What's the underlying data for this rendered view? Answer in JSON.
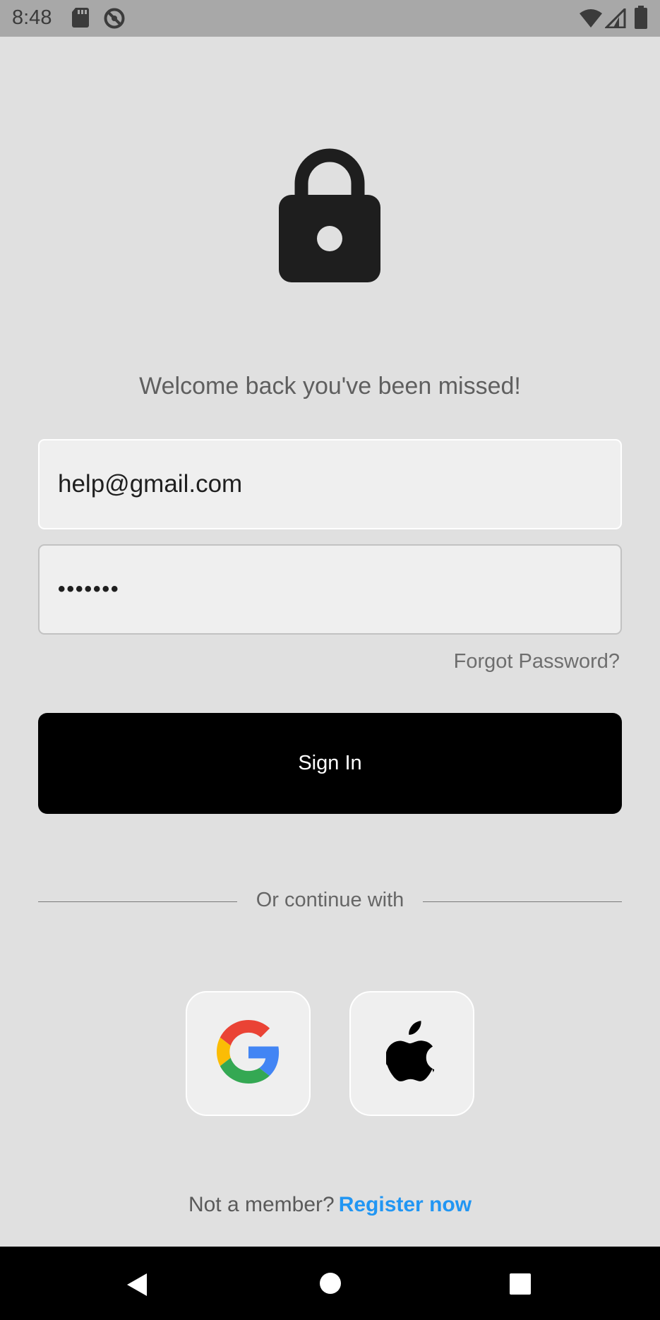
{
  "status_bar": {
    "time": "8:48",
    "icons": [
      "sd-card-icon",
      "do-not-disturb-icon",
      "wifi-icon",
      "signal-icon",
      "battery-icon"
    ]
  },
  "header": {
    "icon": "lock-icon",
    "welcome_text": "Welcome back you've been missed!"
  },
  "form": {
    "email_value": "help@gmail.com",
    "password_value": "•••••••",
    "forgot_label": "Forgot Password?",
    "signin_label": "Sign In"
  },
  "divider": {
    "text": "Or continue with"
  },
  "social": [
    {
      "name": "google",
      "icon": "google-logo-icon"
    },
    {
      "name": "apple",
      "icon": "apple-logo-icon"
    }
  ],
  "footer": {
    "prompt": "Not a member?",
    "register_label": "Register now"
  },
  "colors": {
    "background": "#e0e0e0",
    "field_bg": "#efefef",
    "button_bg": "#000000",
    "link": "#2196f3",
    "status_bar": "#a8a8a8"
  },
  "nav_bar": {
    "icons": [
      "back-icon",
      "home-icon",
      "recent-apps-icon"
    ]
  }
}
